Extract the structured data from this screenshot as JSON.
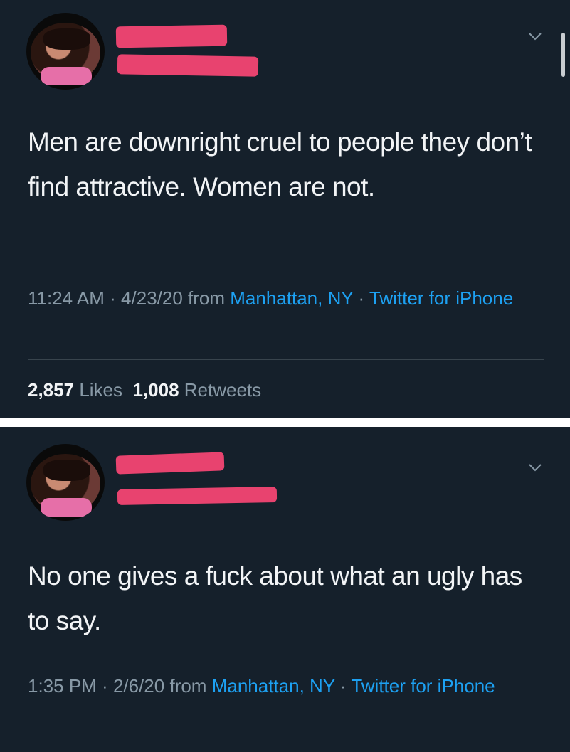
{
  "tweets": [
    {
      "text": "Men are downright cruel to people they don’t find attractive. Women are not.",
      "time": "11:24 AM",
      "date": "4/23/20",
      "from_label": "from",
      "location": "Manhattan, NY",
      "client": "Twitter for iPhone",
      "separator": " · ",
      "stats": {
        "likes_count": "2,857",
        "likes_label": "Likes",
        "retweets_count": "1,008",
        "retweets_label": "Retweets"
      }
    },
    {
      "text": "No one gives a fuck about what an ugly has to say.",
      "time": "1:35 PM",
      "date": "2/6/20",
      "from_label": "from",
      "location": "Manhattan, NY",
      "client": "Twitter for iPhone",
      "separator": " · "
    }
  ],
  "icons": {
    "chevron": "chevron-down-icon",
    "avatar": "avatar"
  },
  "colors": {
    "background": "#15202b",
    "text": "#f2f4f6",
    "secondary": "#8899a6",
    "link": "#1da1f2",
    "redaction": "#e8436f",
    "gap": "#ffffff"
  }
}
